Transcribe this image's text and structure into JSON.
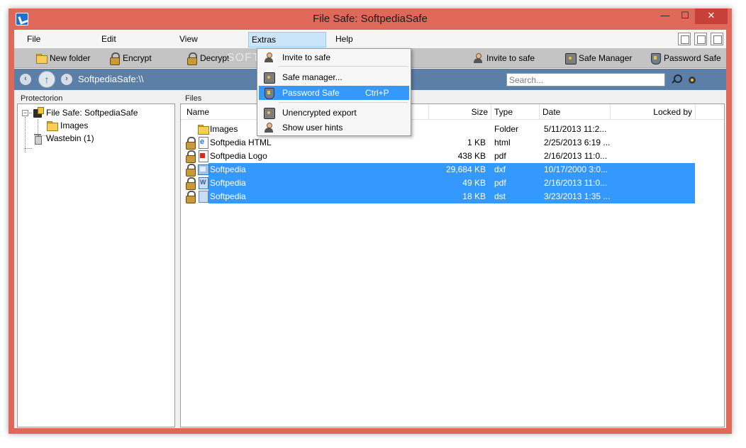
{
  "window": {
    "title": "File Safe: SoftpediaSafe"
  },
  "menubar": {
    "items": [
      "File",
      "Edit",
      "View",
      "Extras",
      "Help"
    ]
  },
  "toolbar": {
    "new_folder": "New folder",
    "encrypt": "Encrypt",
    "decrypt": "Decrypt",
    "invite": "Invite to safe",
    "safe_manager": "Safe Manager",
    "password_safe": "Password Safe",
    "watermark": "SOFTPEDIA"
  },
  "nav": {
    "path": "SoftpediaSafe:\\\\",
    "search_placeholder": "Search..."
  },
  "panes": {
    "left_title": "Protectorion",
    "right_title": "Files"
  },
  "tree": {
    "root": "File Safe: SoftpediaSafe",
    "images": "Images",
    "wastebin": "Wastebin (1)"
  },
  "files": {
    "columns": [
      "Name",
      "Size",
      "Type",
      "Date",
      "Locked by"
    ],
    "rows": [
      {
        "name": "Images",
        "size": "",
        "type": "Folder",
        "date": "5/11/2013 11:2...",
        "icon": "folder-icon",
        "locked": false,
        "selected": false
      },
      {
        "name": "Softpedia HTML",
        "size": "1 KB",
        "type": "html",
        "date": "2/25/2013 6:19 ...",
        "icon": "html-file-icon",
        "locked": true,
        "selected": false
      },
      {
        "name": "Softpedia Logo",
        "size": "438 KB",
        "type": "pdf",
        "date": "2/16/2013 11:0...",
        "icon": "pdf-file-icon",
        "locked": true,
        "selected": false
      },
      {
        "name": "Softpedia",
        "size": "29,684 KB",
        "type": "dxf",
        "date": "10/17/2000 3:0...",
        "icon": "dxf-file-icon",
        "locked": true,
        "selected": true
      },
      {
        "name": "Softpedia",
        "size": "49 KB",
        "type": "pdf",
        "date": "2/16/2013 11:0...",
        "icon": "word-file-icon",
        "locked": true,
        "selected": true
      },
      {
        "name": "Softpedia",
        "size": "18 KB",
        "type": "dst",
        "date": "3/23/2013 1:35 ...",
        "icon": "dst-file-icon",
        "locked": true,
        "selected": true
      }
    ]
  },
  "extras_menu": {
    "invite": "Invite to safe",
    "safe_manager": "Safe manager...",
    "password_safe": "Password Safe",
    "password_safe_shortcut": "Ctrl+P",
    "unencrypted_export": "Unencrypted export",
    "show_hints": "Show user hints"
  },
  "colors": {
    "title_bar": "#e0685a",
    "nav_bar": "#5b7fa6",
    "selection": "#3399ff",
    "toolbar": "#c4c4c4"
  }
}
